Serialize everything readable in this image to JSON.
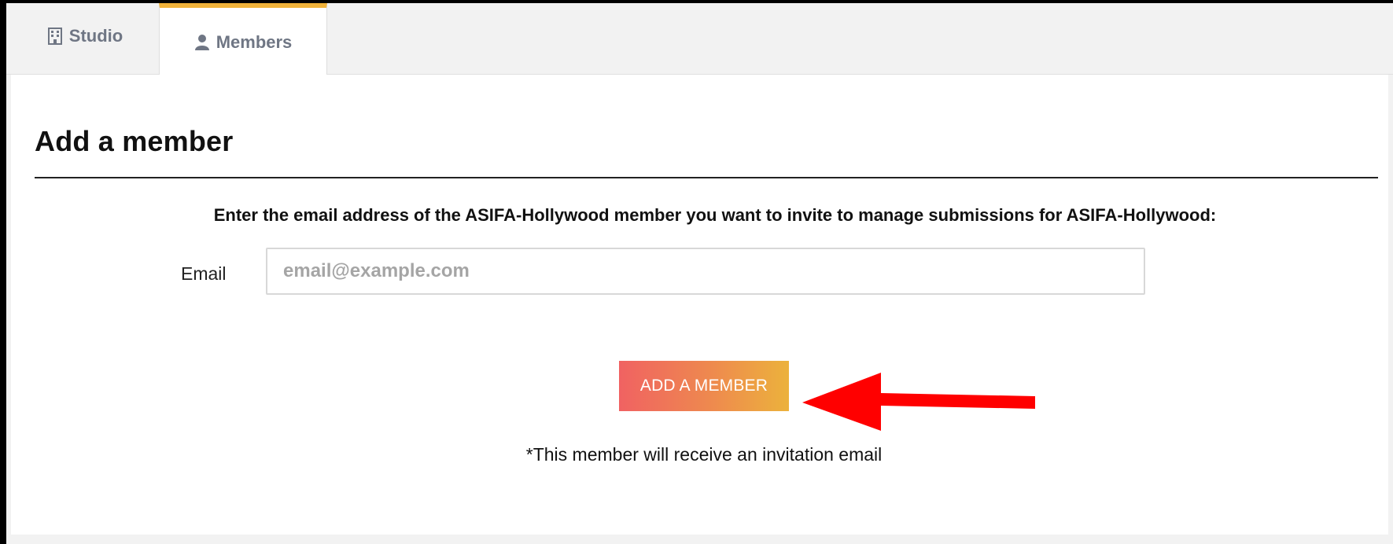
{
  "tabs": {
    "studio": {
      "label": "Studio",
      "icon": "building-icon"
    },
    "members": {
      "label": "Members",
      "icon": "user-icon",
      "active": true,
      "accent_color": "#f0b23a"
    }
  },
  "page": {
    "title": "Add a member",
    "instructions": "Enter the email address of the ASIFA-Hollywood member you want to invite to manage submissions for ASIFA-Hollywood:"
  },
  "form": {
    "email_label": "Email",
    "email_value": "",
    "email_placeholder": "email@example.com",
    "submit_label": "ADD A MEMBER",
    "note": "*This member will receive an invitation email"
  },
  "colors": {
    "button_gradient_start": "#f06262",
    "button_gradient_end": "#ecb23c",
    "annotation_arrow": "#ff0000"
  }
}
